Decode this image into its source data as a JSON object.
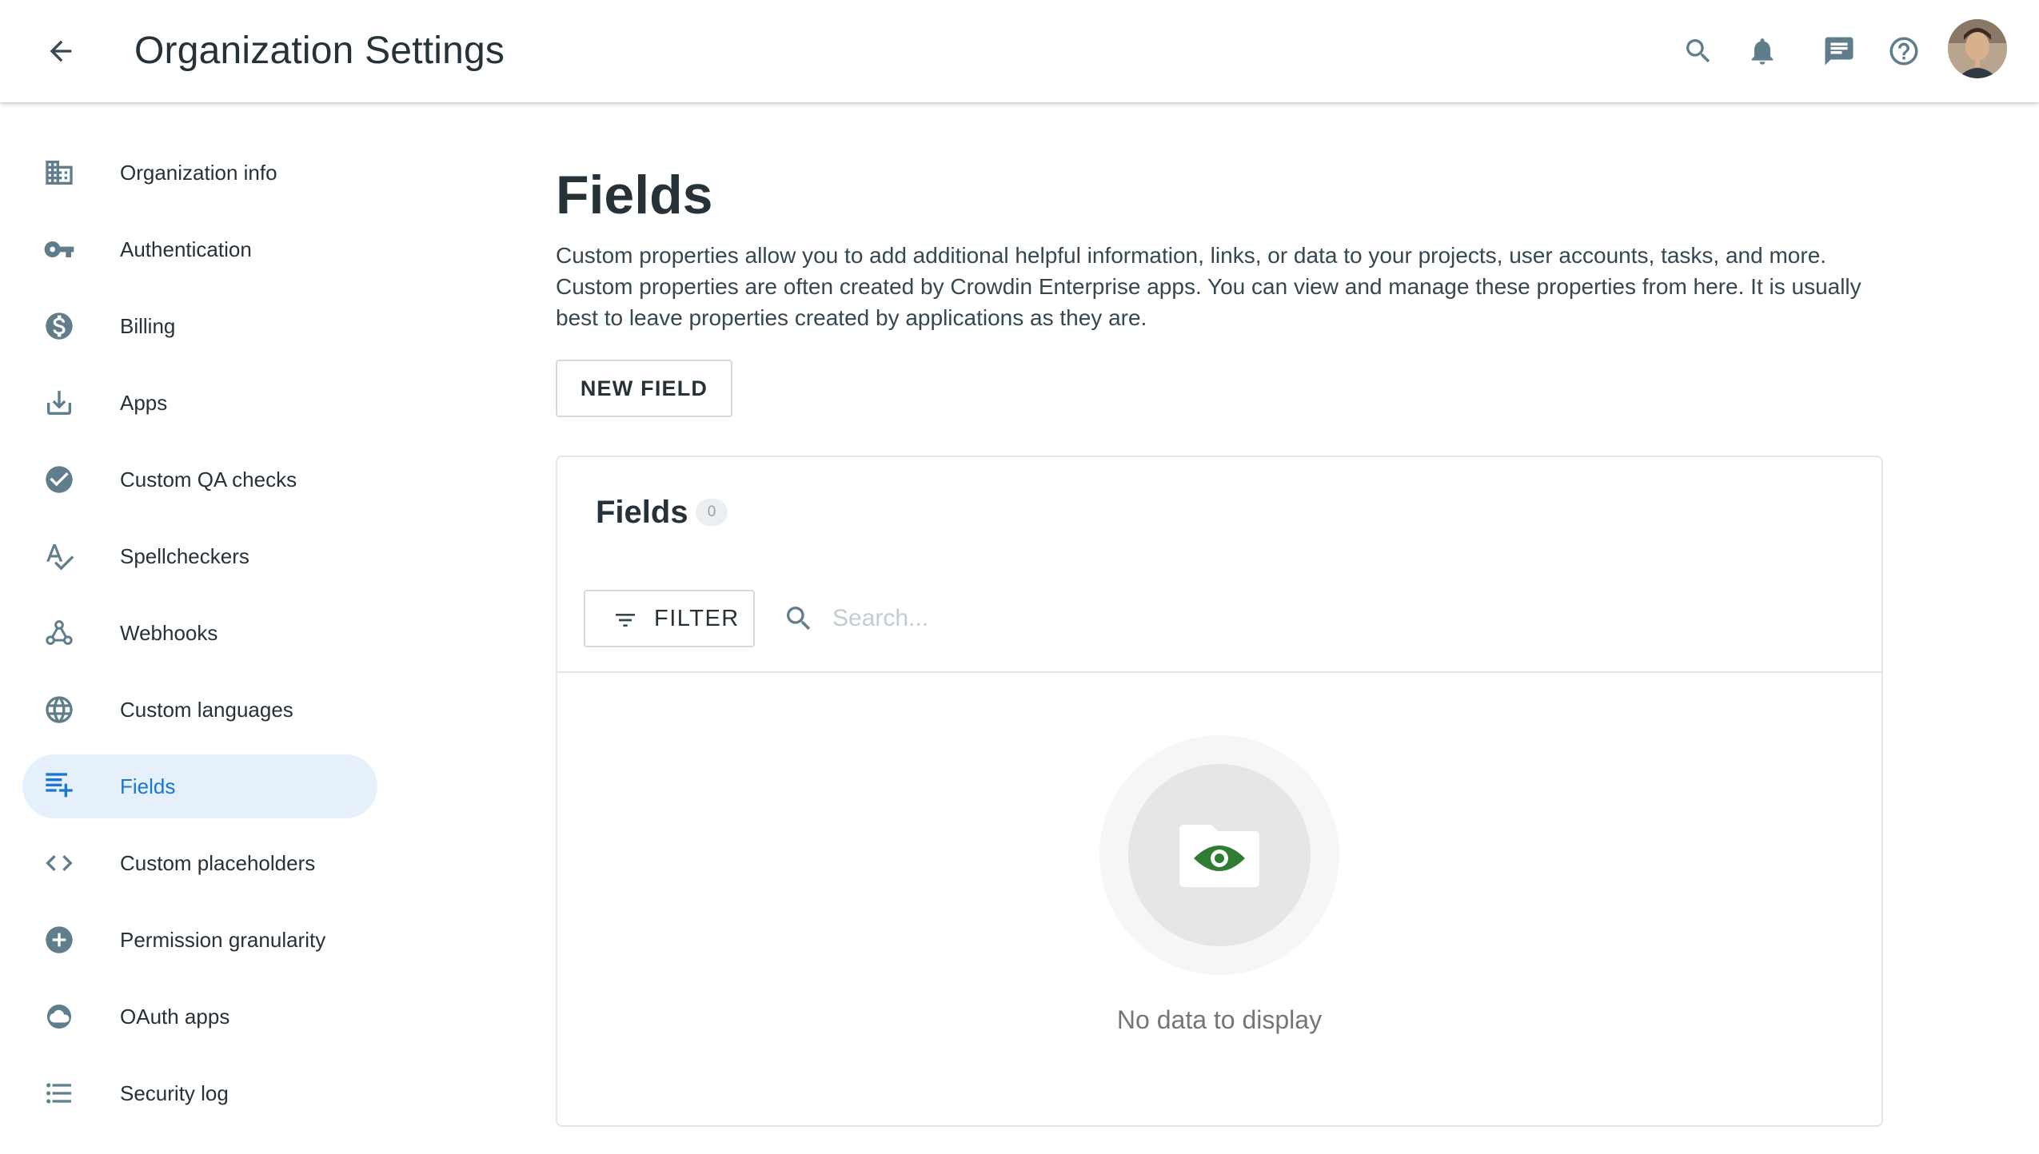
{
  "appbar": {
    "title": "Organization Settings",
    "icons": [
      "back-arrow-icon",
      "search-icon",
      "bell-icon",
      "chat-icon",
      "help-icon",
      "avatar"
    ]
  },
  "sidebar": {
    "items": [
      {
        "label": "Organization info",
        "icon": "building-icon",
        "active": false
      },
      {
        "label": "Authentication",
        "icon": "key-icon",
        "active": false
      },
      {
        "label": "Billing",
        "icon": "dollar-icon",
        "active": false
      },
      {
        "label": "Apps",
        "icon": "download-icon",
        "active": false
      },
      {
        "label": "Custom QA checks",
        "icon": "check-circle-icon",
        "active": false
      },
      {
        "label": "Spellcheckers",
        "icon": "spellcheck-icon",
        "active": false
      },
      {
        "label": "Webhooks",
        "icon": "webhook-icon",
        "active": false
      },
      {
        "label": "Custom languages",
        "icon": "globe-icon",
        "active": false
      },
      {
        "label": "Fields",
        "icon": "playlist-add-icon",
        "active": true
      },
      {
        "label": "Custom placeholders",
        "icon": "code-icon",
        "active": false
      },
      {
        "label": "Permission granularity",
        "icon": "add-circle-icon",
        "active": false
      },
      {
        "label": "OAuth apps",
        "icon": "cloud-icon",
        "active": false
      },
      {
        "label": "Security log",
        "icon": "list-icon",
        "active": false
      }
    ]
  },
  "main": {
    "title": "Fields",
    "description": "Custom properties allow you to add additional helpful information, links, or data to your projects, user accounts, tasks, and more. Custom properties are often created by Crowdin Enterprise apps. You can view and manage these properties from here. It is usually best to leave properties created by applications as they are.",
    "new_field_label": "NEW FIELD",
    "card": {
      "title": "Fields",
      "count": "0",
      "filter_label": "FILTER",
      "search_placeholder": "Search...",
      "search_value": "",
      "empty_text": "No data to display"
    }
  },
  "colors": {
    "accent": "#1976d2",
    "active_bg": "#e5f0fb",
    "icon_gray": "#607d8b",
    "empty_eye": "#2e7d32"
  }
}
